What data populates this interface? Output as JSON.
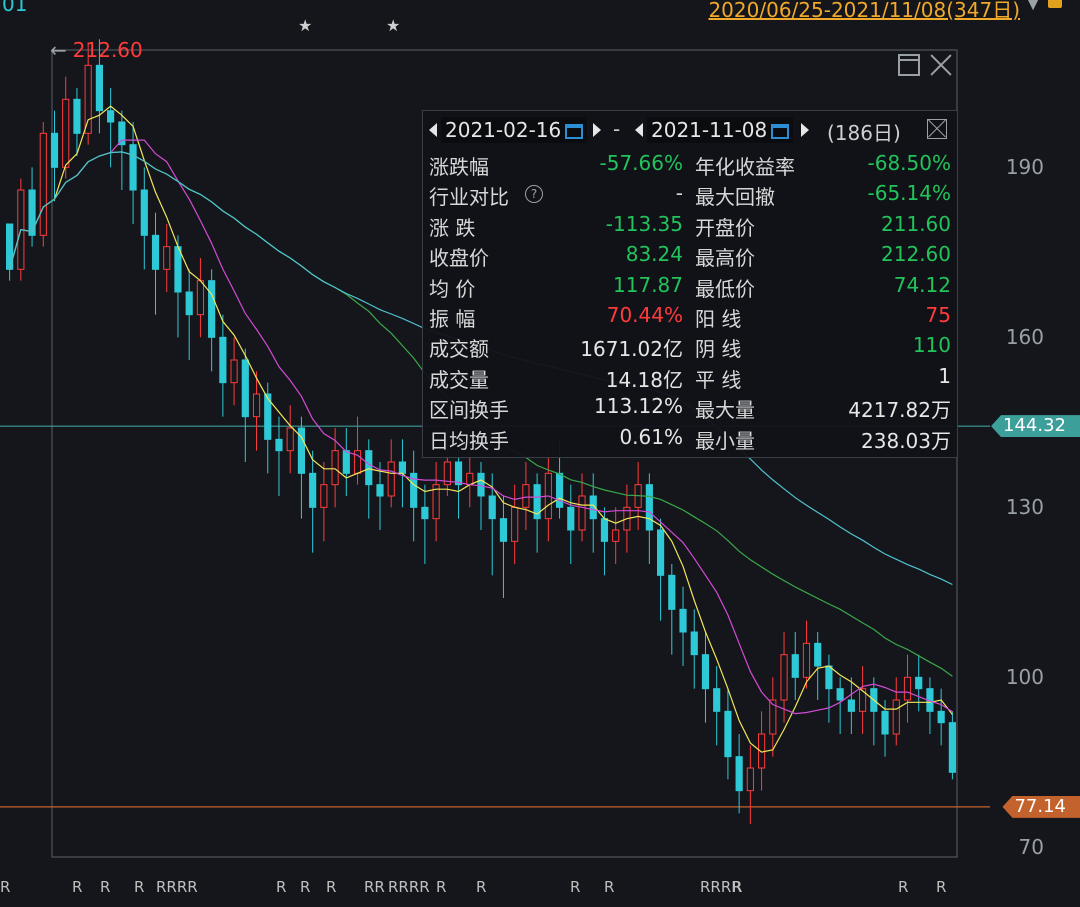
{
  "header": {
    "range_label": "2020/06/25-2021/11/08(347日)",
    "left_tag": "01",
    "stars": [
      "★",
      "★"
    ]
  },
  "chart_data": {
    "type": "candlestick",
    "max_label": "212.60",
    "max_arrow": "←",
    "ylim": [
      66,
      216
    ],
    "yticks": [
      "190",
      "160",
      "130",
      "100",
      "70"
    ],
    "ytick_values": [
      190,
      160,
      130,
      100,
      70
    ],
    "reference_lines": [
      {
        "label": "144.32",
        "value": 144.32,
        "color": "#3d9f9a"
      },
      {
        "label": "77.14",
        "value": 77.14,
        "color": "#c4622d"
      }
    ],
    "up_color": "#ff3b3b",
    "down_color": "#2ec9d7",
    "ma_colors": [
      "#f2e65a",
      "#d44ad6",
      "#3aa84a",
      "#4fc3cf"
    ],
    "bottom_marks": [
      "R",
      "R",
      "R",
      "R",
      "RRRR",
      "R",
      "R",
      "R",
      "RR",
      "RRRR",
      "R",
      "R",
      "R",
      "R",
      "RRRR",
      "R",
      "R",
      "R"
    ],
    "candles": [
      [
        180,
        172,
        178,
        170
      ],
      [
        172,
        186,
        188,
        170
      ],
      [
        186,
        178,
        190,
        176
      ],
      [
        178,
        196,
        198,
        176
      ],
      [
        196,
        190,
        200,
        184
      ],
      [
        190,
        202,
        206,
        188
      ],
      [
        202,
        196,
        204,
        192
      ],
      [
        196,
        208,
        212,
        194
      ],
      [
        208,
        200,
        212.6,
        196
      ],
      [
        200,
        198,
        204,
        190
      ],
      [
        198,
        194,
        200,
        186
      ],
      [
        194,
        186,
        198,
        180
      ],
      [
        186,
        178,
        190,
        172
      ],
      [
        178,
        172,
        182,
        164
      ],
      [
        172,
        176,
        180,
        168
      ],
      [
        176,
        168,
        178,
        160
      ],
      [
        168,
        164,
        172,
        156
      ],
      [
        164,
        170,
        174,
        160
      ],
      [
        170,
        160,
        172,
        154
      ],
      [
        160,
        152,
        164,
        146
      ],
      [
        152,
        156,
        160,
        148
      ],
      [
        156,
        146,
        158,
        138
      ],
      [
        146,
        150,
        154,
        140
      ],
      [
        150,
        142,
        152,
        136
      ],
      [
        142,
        140,
        146,
        132
      ],
      [
        140,
        144,
        148,
        136
      ],
      [
        144,
        136,
        146,
        128
      ],
      [
        136,
        130,
        140,
        122
      ],
      [
        130,
        134,
        138,
        124
      ],
      [
        134,
        140,
        144,
        130
      ],
      [
        140,
        136,
        144,
        132
      ],
      [
        136,
        140,
        146,
        134
      ],
      [
        140,
        134,
        142,
        128
      ],
      [
        134,
        132,
        138,
        126
      ],
      [
        132,
        138,
        142,
        130
      ],
      [
        138,
        136,
        142,
        130
      ],
      [
        136,
        130,
        140,
        124
      ],
      [
        130,
        128,
        134,
        120
      ],
      [
        128,
        134,
        138,
        124
      ],
      [
        134,
        138,
        144,
        132
      ],
      [
        138,
        134,
        140,
        128
      ],
      [
        134,
        136,
        140,
        130
      ],
      [
        136,
        132,
        138,
        126
      ],
      [
        132,
        128,
        136,
        118
      ],
      [
        128,
        124,
        132,
        114
      ],
      [
        124,
        130,
        134,
        120
      ],
      [
        130,
        134,
        138,
        126
      ],
      [
        134,
        128,
        136,
        122
      ],
      [
        128,
        136,
        140,
        124
      ],
      [
        136,
        130,
        142,
        128
      ],
      [
        130,
        126,
        134,
        120
      ],
      [
        126,
        132,
        136,
        124
      ],
      [
        132,
        128,
        136,
        122
      ],
      [
        128,
        124,
        130,
        118
      ],
      [
        124,
        126,
        130,
        120
      ],
      [
        126,
        130,
        134,
        122
      ],
      [
        130,
        134,
        138,
        126
      ],
      [
        134,
        126,
        136,
        120
      ],
      [
        126,
        118,
        128,
        110
      ],
      [
        118,
        112,
        120,
        104
      ],
      [
        112,
        108,
        116,
        102
      ],
      [
        108,
        104,
        112,
        98
      ],
      [
        104,
        98,
        108,
        92
      ],
      [
        98,
        94,
        102,
        88
      ],
      [
        94,
        86,
        98,
        82
      ],
      [
        86,
        80,
        90,
        76
      ],
      [
        80,
        84,
        88,
        74.12
      ],
      [
        84,
        90,
        94,
        80
      ],
      [
        90,
        96,
        100,
        86
      ],
      [
        96,
        104,
        108,
        92
      ],
      [
        104,
        100,
        108,
        96
      ],
      [
        100,
        106,
        110,
        98
      ],
      [
        106,
        102,
        108,
        96
      ],
      [
        102,
        98,
        104,
        92
      ],
      [
        98,
        96,
        100,
        90
      ],
      [
        96,
        94,
        100,
        90
      ],
      [
        94,
        98,
        102,
        90
      ],
      [
        98,
        94,
        100,
        88
      ],
      [
        94,
        90,
        96,
        86
      ],
      [
        90,
        96,
        100,
        88
      ],
      [
        96,
        100,
        104,
        92
      ],
      [
        100,
        98,
        104,
        94
      ],
      [
        98,
        94,
        100,
        90
      ],
      [
        94,
        92,
        98,
        88
      ],
      [
        92,
        83.24,
        94,
        82
      ]
    ]
  },
  "window_controls": {
    "maximize": "maximize",
    "close": "close"
  },
  "stats_panel": {
    "start_date": "2021-02-16",
    "dash": "-",
    "end_date": "2021-11-08",
    "days": "(186日)",
    "rows": [
      {
        "l_label": "涨跌幅",
        "l_value": "-57.66%",
        "l_color": "#22c35b",
        "r_label": "年化收益率",
        "r_value": "-68.50%",
        "r_color": "#22c35b"
      },
      {
        "l_label": "行业对比",
        "l_value": "-",
        "l_color": "#d8d8d8",
        "r_label": "最大回撤",
        "r_value": "-65.14%",
        "r_color": "#22c35b",
        "help": "?"
      },
      {
        "l_label": "涨  跌",
        "l_value": "-113.35",
        "l_color": "#22c35b",
        "r_label": "开盘价",
        "r_value": "211.60",
        "r_color": "#22c35b"
      },
      {
        "l_label": "收盘价",
        "l_value": "83.24",
        "l_color": "#22c35b",
        "r_label": "最高价",
        "r_value": "212.60",
        "r_color": "#22c35b"
      },
      {
        "l_label": "均  价",
        "l_value": "117.87",
        "l_color": "#22c35b",
        "r_label": "最低价",
        "r_value": "74.12",
        "r_color": "#22c35b"
      },
      {
        "l_label": "振  幅",
        "l_value": "70.44%",
        "l_color": "#ff3b3b",
        "r_label": "阳  线",
        "r_value": "75",
        "r_color": "#ff3b3b"
      },
      {
        "l_label": "成交额",
        "l_value": "1671.02亿",
        "l_color": "#e6e6e6",
        "r_label": "阴  线",
        "r_value": "110",
        "r_color": "#22c35b"
      },
      {
        "l_label": "成交量",
        "l_value": "14.18亿",
        "l_color": "#e6e6e6",
        "r_label": "平  线",
        "r_value": "1",
        "r_color": "#e6e6e6"
      },
      {
        "l_label": "区间换手",
        "l_value": "113.12%",
        "l_color": "#e6e6e6",
        "r_label": "最大量",
        "r_value": "4217.82万",
        "r_color": "#e6e6e6"
      },
      {
        "l_label": "日均换手",
        "l_value": "0.61%",
        "l_color": "#e6e6e6",
        "r_label": "最小量",
        "r_value": "238.03万",
        "r_color": "#e6e6e6"
      }
    ]
  }
}
